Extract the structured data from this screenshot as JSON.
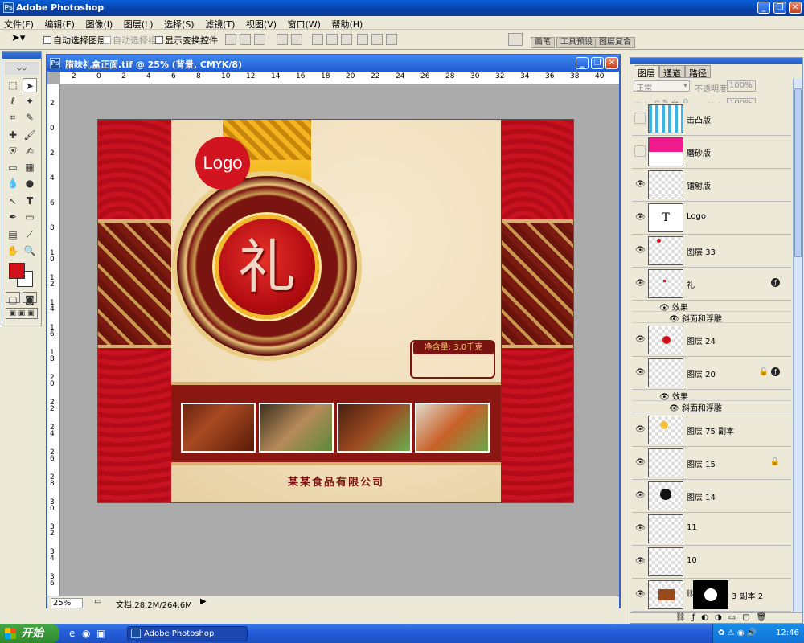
{
  "app": {
    "title": "Adobe Photoshop",
    "icon": "photoshop-icon"
  },
  "menubar": {
    "items": [
      "文件(F)",
      "编辑(E)",
      "图像(I)",
      "图层(L)",
      "选择(S)",
      "滤镜(T)",
      "视图(V)",
      "窗口(W)",
      "帮助(H)"
    ]
  },
  "options": {
    "auto_select_layer": "自动选择图层",
    "auto_select_group": "自动选择组",
    "show_transform": "显示变换控件",
    "well_tabs": [
      "画笔",
      "工具预设",
      "图层复合"
    ]
  },
  "document": {
    "title": "腊味礼盒正面.tif @ 25% (背景, CMYK/8)",
    "zoom": "25%",
    "doc_info": "文档:28.2M/264.6M",
    "ruler_top": [
      "2",
      "0",
      "2",
      "4",
      "6",
      "8",
      "10",
      "12",
      "14",
      "16",
      "18",
      "20",
      "22",
      "24",
      "26",
      "28",
      "30",
      "32",
      "34",
      "36",
      "38",
      "40"
    ],
    "ruler_left": [
      "2",
      "0",
      "2",
      "4",
      "6",
      "8",
      "10",
      "12",
      "14",
      "16",
      "18",
      "20",
      "22",
      "24",
      "26",
      "28",
      "30",
      "32",
      "34",
      "36"
    ]
  },
  "artwork": {
    "logo": "Logo",
    "main_char": "礼",
    "net_weight": "净含量: 3.0千克",
    "company": "某某食品有限公司",
    "colors": {
      "red": "#c40e1a",
      "cream": "#efdcb6",
      "gold": "#f3b72a",
      "maroon": "#7a1410"
    }
  },
  "layers_panel": {
    "tabs": [
      "图层",
      "通道",
      "路径"
    ],
    "blend_mode": "正常",
    "opacity_label": "不透明度:",
    "opacity_value": "100%",
    "lock_label": "锁定:",
    "fill_label": "填充:",
    "fill_value": "100%",
    "effects_label": "效果",
    "bevel_label": "斜面和浮雕",
    "layers": [
      {
        "name": "击凸版",
        "visible": false
      },
      {
        "name": "磨砂版",
        "visible": false
      },
      {
        "name": "镭射版",
        "visible": true
      },
      {
        "name": "Logo",
        "visible": true,
        "type": "text"
      },
      {
        "name": "图层 33",
        "visible": true
      },
      {
        "name": "礼",
        "visible": true,
        "fx": true
      },
      {
        "name": "图层 24",
        "visible": true
      },
      {
        "name": "图层 20",
        "visible": true,
        "fx": true,
        "locked": true
      },
      {
        "name": "图层 75 副本",
        "visible": true
      },
      {
        "name": "图层 15",
        "visible": true,
        "locked": true
      },
      {
        "name": "图层 14",
        "visible": true
      },
      {
        "name": "11",
        "visible": true
      },
      {
        "name": "10",
        "visible": true
      },
      {
        "name": "3 副本 2",
        "visible": true,
        "mask": true
      }
    ]
  },
  "taskbar": {
    "start": "开始",
    "task": "Adobe Photoshop",
    "time": "12:46"
  }
}
